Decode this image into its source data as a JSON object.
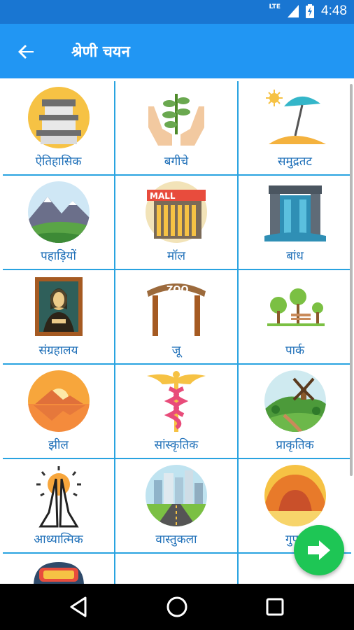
{
  "status_bar": {
    "network": "LTE",
    "time": "4:48"
  },
  "app_bar": {
    "title": "श्रेणी चयन",
    "back_icon": "arrow-left-icon"
  },
  "categories": [
    {
      "label": "ऐतिहासिक",
      "icon": "palace-icon"
    },
    {
      "label": "बगीचे",
      "icon": "plant-hands-icon"
    },
    {
      "label": "समुद्रतट",
      "icon": "beach-umbrella-icon"
    },
    {
      "label": "पहाड़ियों",
      "icon": "mountains-icon"
    },
    {
      "label": "मॉल",
      "icon": "mall-icon"
    },
    {
      "label": "बांध",
      "icon": "dam-icon"
    },
    {
      "label": "संग्रहालय",
      "icon": "portrait-painting-icon"
    },
    {
      "label": "जू",
      "icon": "zoo-gate-icon"
    },
    {
      "label": "पार्क",
      "icon": "park-bench-icon"
    },
    {
      "label": "झील",
      "icon": "lake-sunset-icon"
    },
    {
      "label": "सांस्कृतिक",
      "icon": "caduceus-icon"
    },
    {
      "label": "प्राकृतिक",
      "icon": "windmill-hill-icon"
    },
    {
      "label": "आध्यात्मिक",
      "icon": "praying-hands-icon"
    },
    {
      "label": "वास्तुकला",
      "icon": "city-road-icon"
    },
    {
      "label": "गुफा",
      "icon": "cave-icon"
    },
    {
      "label": "",
      "icon": "train-icon"
    },
    {
      "label": "",
      "icon": ""
    },
    {
      "label": "",
      "icon": ""
    }
  ],
  "fab": {
    "icon": "arrow-right-icon",
    "color": "#1ec655"
  },
  "nav": {
    "back_icon": "nav-back-icon",
    "home_icon": "nav-home-icon",
    "recents_icon": "nav-recents-icon"
  },
  "colors": {
    "status_bar": "#1976d2",
    "app_bar": "#2196f3",
    "grid_line": "#29a3e0",
    "label": "#1e6fb8"
  }
}
